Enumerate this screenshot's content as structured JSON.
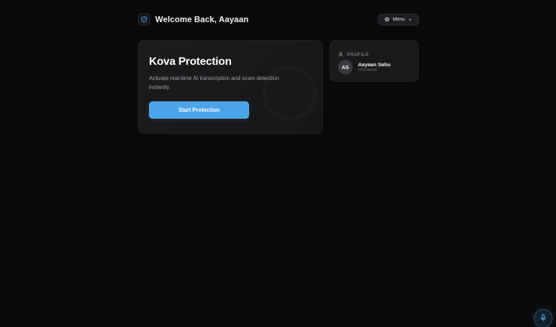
{
  "header": {
    "welcome_text": "Welcome Back, Aayaan",
    "menu_label": "Menu"
  },
  "protection": {
    "title": "Kova Protection",
    "description": "Activate real-time AI transcription and scam detection instantly.",
    "start_button_label": "Start Protection"
  },
  "profile": {
    "section_label": "PROFILE",
    "initials": "AS",
    "name": "Aayaan Sahu",
    "phone": "5510244756"
  },
  "icons": {
    "logo": "shield-logo-icon",
    "menu": "gear-icon",
    "menu_chevron": "chevron-down-icon",
    "profile": "user-icon",
    "mic": "microphone-icon"
  },
  "colors": {
    "background": "#0a0a0b",
    "accent": "#4ba3e8",
    "card": "#1a1a1c"
  }
}
